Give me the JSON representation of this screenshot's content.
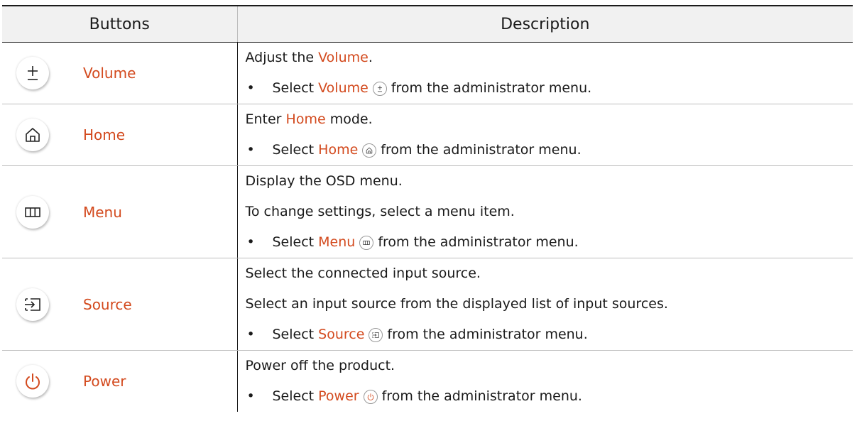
{
  "table": {
    "headers": [
      "Buttons",
      "Description"
    ],
    "accent_color": "#d34a1e",
    "rows": [
      {
        "icon": "plus-minus-icon",
        "name": "Volume",
        "lines": [
          {
            "pre": "Adjust the ",
            "hl": "Volume",
            "post": "."
          }
        ],
        "bullet": {
          "pre": "Select ",
          "hl": "Volume",
          "post": "from the administrator menu."
        }
      },
      {
        "icon": "home-icon",
        "name": "Home",
        "lines": [
          {
            "pre": "Enter ",
            "hl": "Home",
            "post": " mode."
          }
        ],
        "bullet": {
          "pre": "Select ",
          "hl": "Home",
          "post": "from the administrator menu."
        }
      },
      {
        "icon": "menu-icon",
        "name": "Menu",
        "lines": [
          {
            "pre": "Display the OSD menu.",
            "hl": "",
            "post": ""
          },
          {
            "pre": "To change settings, select a menu item.",
            "hl": "",
            "post": ""
          }
        ],
        "bullet": {
          "pre": "Select ",
          "hl": "Menu",
          "post": "from the administrator menu."
        }
      },
      {
        "icon": "source-icon",
        "name": "Source",
        "lines": [
          {
            "pre": "Select the connected input source.",
            "hl": "",
            "post": ""
          },
          {
            "pre": "Select an input source from the displayed list of input sources.",
            "hl": "",
            "post": ""
          }
        ],
        "bullet": {
          "pre": "Select ",
          "hl": "Source",
          "post": "from the administrator menu."
        }
      },
      {
        "icon": "power-icon",
        "name": "Power",
        "lines": [
          {
            "pre": "Power off the product.",
            "hl": "",
            "post": ""
          }
        ],
        "bullet": {
          "pre": "Select ",
          "hl": "Power",
          "post": "from the administrator menu."
        }
      }
    ]
  }
}
